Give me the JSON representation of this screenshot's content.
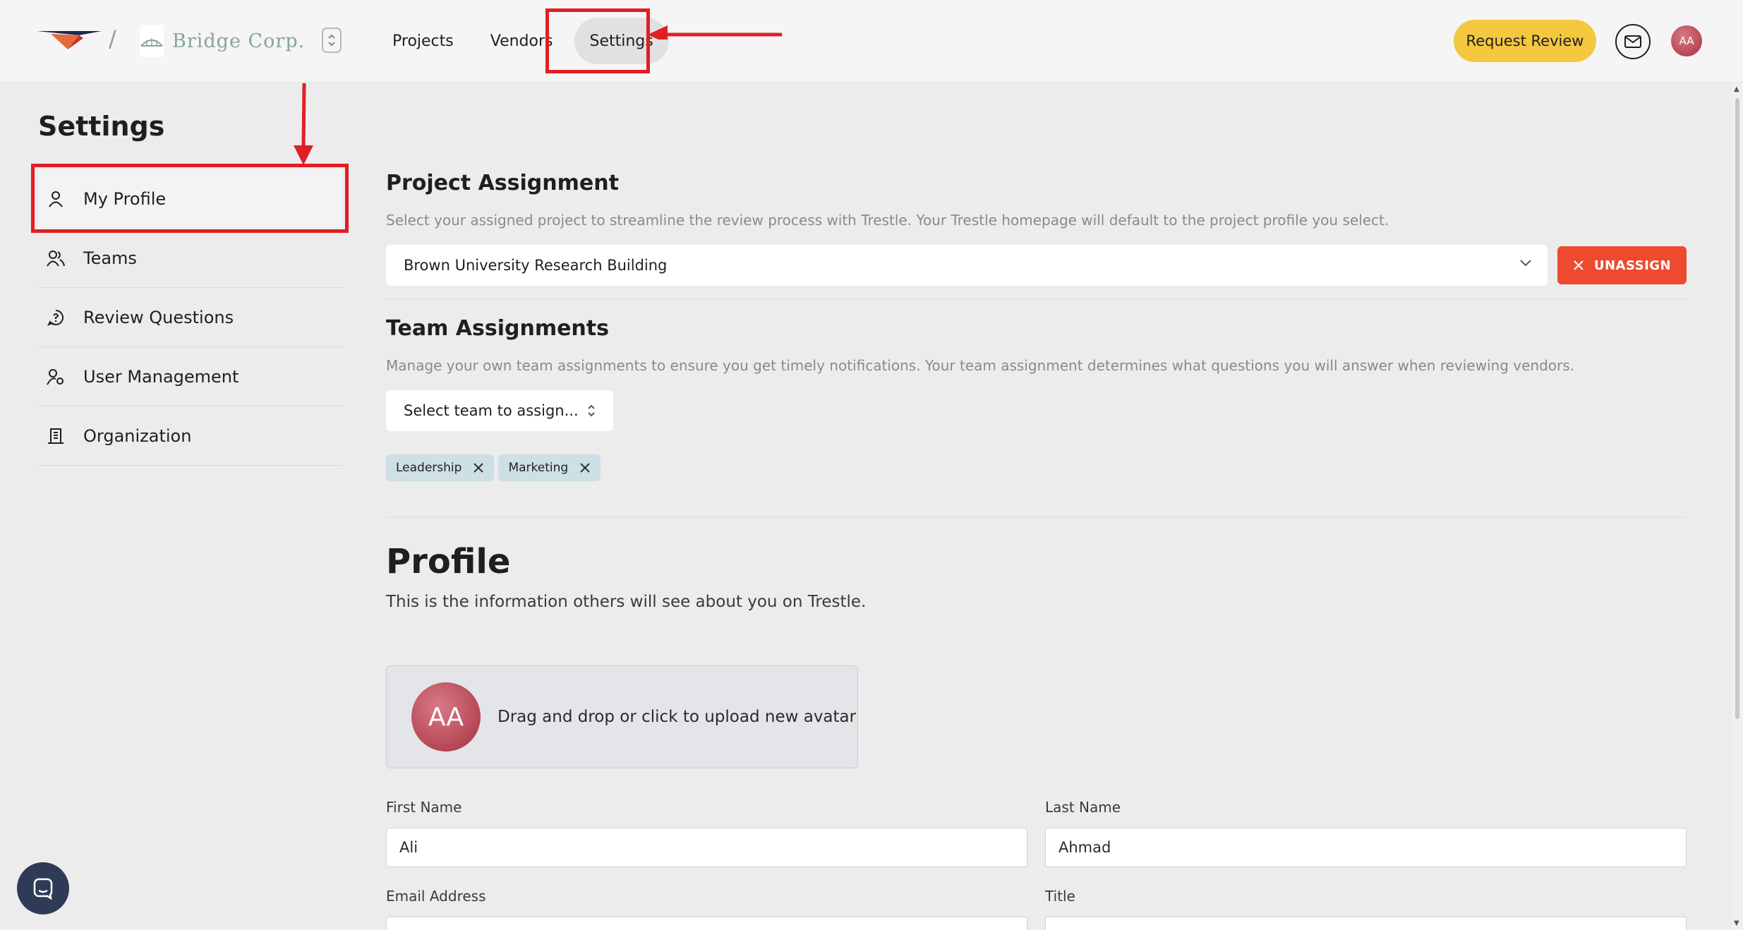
{
  "header": {
    "separator": "/",
    "org_name": "Bridge Corp.",
    "nav": [
      {
        "label": "Projects"
      },
      {
        "label": "Vendors"
      },
      {
        "label": "Settings"
      }
    ],
    "request_review_label": "Request Review",
    "avatar_initials": "AA"
  },
  "sidebar": {
    "title": "Settings",
    "items": [
      {
        "label": "My Profile",
        "icon": "user-icon"
      },
      {
        "label": "Teams",
        "icon": "users-icon"
      },
      {
        "label": "Review Questions",
        "icon": "chat-question-icon"
      },
      {
        "label": "User Management",
        "icon": "user-gear-icon"
      },
      {
        "label": "Organization",
        "icon": "building-icon"
      }
    ]
  },
  "project_assignment": {
    "title": "Project Assignment",
    "description": "Select your assigned project to streamline the review process with Trestle. Your Trestle homepage will default to the project profile you select.",
    "selected_project": "Brown University Research Building",
    "unassign_label": "UNASSIGN"
  },
  "team_assignments": {
    "title": "Team Assignments",
    "description": "Manage your own team assignments to ensure you get timely notifications. Your team assignment determines what questions you will answer when reviewing vendors.",
    "select_placeholder": "Select team to assign...",
    "teams": [
      "Leadership",
      "Marketing"
    ]
  },
  "profile": {
    "title": "Profile",
    "subtitle": "This is the information others will see about you on Trestle.",
    "avatar_initials": "AA",
    "upload_text": "Drag and drop or click to upload new avatar",
    "first_name_label": "First Name",
    "first_name_value": "Ali",
    "last_name_label": "Last Name",
    "last_name_value": "Ahmad",
    "email_label": "Email Address",
    "email_value": "",
    "title_label": "Title",
    "title_value": ""
  },
  "colors": {
    "accent_yellow": "#f3c83f",
    "unassign_red": "#ed4a2f",
    "annotation_red": "#e01f25",
    "chip_blue": "#cde0e6",
    "chat_button": "#2f3a56"
  }
}
